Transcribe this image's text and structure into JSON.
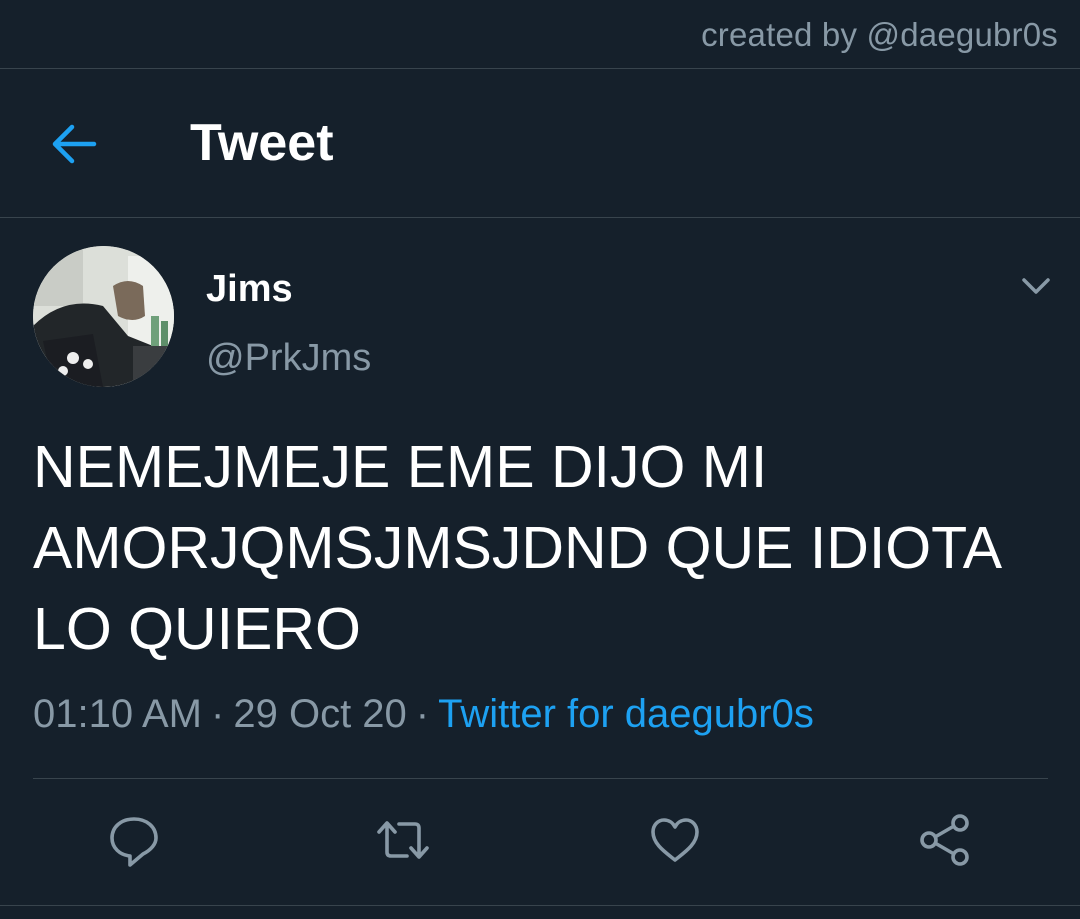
{
  "credit": "created by @daegubr0s",
  "header": {
    "title": "Tweet",
    "back_icon": "arrow-left-icon"
  },
  "tweet": {
    "display_name": "Jims",
    "handle": "@PrkJms",
    "text": "NEMEJMEJE EME DIJO MI\nAMORJQMSJMSJDND QUE IDIOTA\nLO QUIERO",
    "time": "01:10 AM",
    "separator": "·",
    "date": "29 Oct 20",
    "source": "Twitter for daegubr0s"
  },
  "actions": [
    {
      "name": "reply",
      "icon": "speech-bubble-icon"
    },
    {
      "name": "retweet",
      "icon": "retweet-arrows-icon"
    },
    {
      "name": "like",
      "icon": "heart-icon"
    },
    {
      "name": "share",
      "icon": "share-nodes-icon"
    }
  ],
  "colors": {
    "background": "#15202b",
    "accent": "#1da1f2",
    "muted_text": "#8899a6",
    "border": "#38444d",
    "primary_text": "#ffffff"
  }
}
